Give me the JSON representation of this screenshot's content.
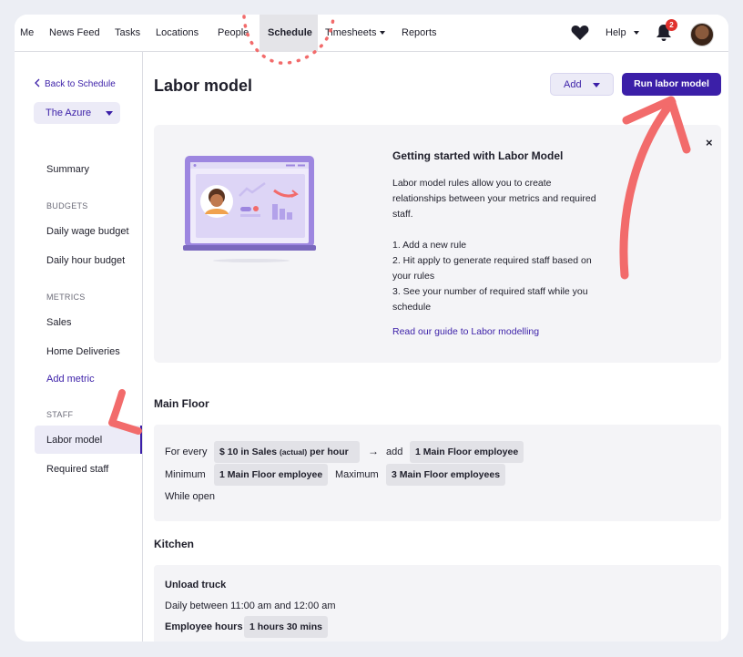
{
  "nav": {
    "items": [
      "Me",
      "News Feed",
      "Tasks",
      "Locations",
      "People",
      "Schedule",
      "Timesheets",
      "Reports"
    ],
    "help_label": "Help",
    "notification_count": "2"
  },
  "sidebar": {
    "back_label": "Back to Schedule",
    "location": "The Azure",
    "summary": "Summary",
    "budgets_header": "BUDGETS",
    "daily_wage_budget": "Daily wage budget",
    "daily_hour_budget": "Daily hour budget",
    "metrics_header": "METRICS",
    "sales": "Sales",
    "home_deliveries": "Home Deliveries",
    "add_metric": "Add metric",
    "staff_header": "STAFF",
    "labor_model": "Labor model",
    "required_staff": "Required staff"
  },
  "header": {
    "title": "Labor model",
    "add_label": "Add",
    "run_label": "Run labor model"
  },
  "intro_card": {
    "title": "Getting started with Labor Model",
    "para": "Labor model rules allow you to create relationships between your metrics and required staff.",
    "step1": "1. Add a new rule",
    "step2": "2. Hit apply to generate required staff based on your rules",
    "step3": "3. See your number of required staff while you schedule",
    "link": "Read our guide to Labor modelling",
    "close": "×"
  },
  "main_floor": {
    "title": "Main Floor",
    "for_every": "For every",
    "metric_prefix": "$ 10 in Sales",
    "metric_actual": "(actual)",
    "metric_suffix": "per hour",
    "arrow": "→",
    "add": "add",
    "add_value": "1 Main Floor employee",
    "minimum": "Minimum",
    "minimum_value": "1 Main Floor employee",
    "maximum": "Maximum",
    "maximum_value": "3 Main Floor employees",
    "while_open": "While open"
  },
  "kitchen": {
    "title": "Kitchen",
    "task_title": "Unload truck",
    "schedule": "Daily between 11:00 am and 12:00 am",
    "employee_hours_label": "Employee hours",
    "employee_hours_value": "1 hours 30 mins"
  },
  "colors": {
    "accent": "#3b1fa8",
    "annotation": "#f26b6b",
    "badge": "#e0312d"
  }
}
